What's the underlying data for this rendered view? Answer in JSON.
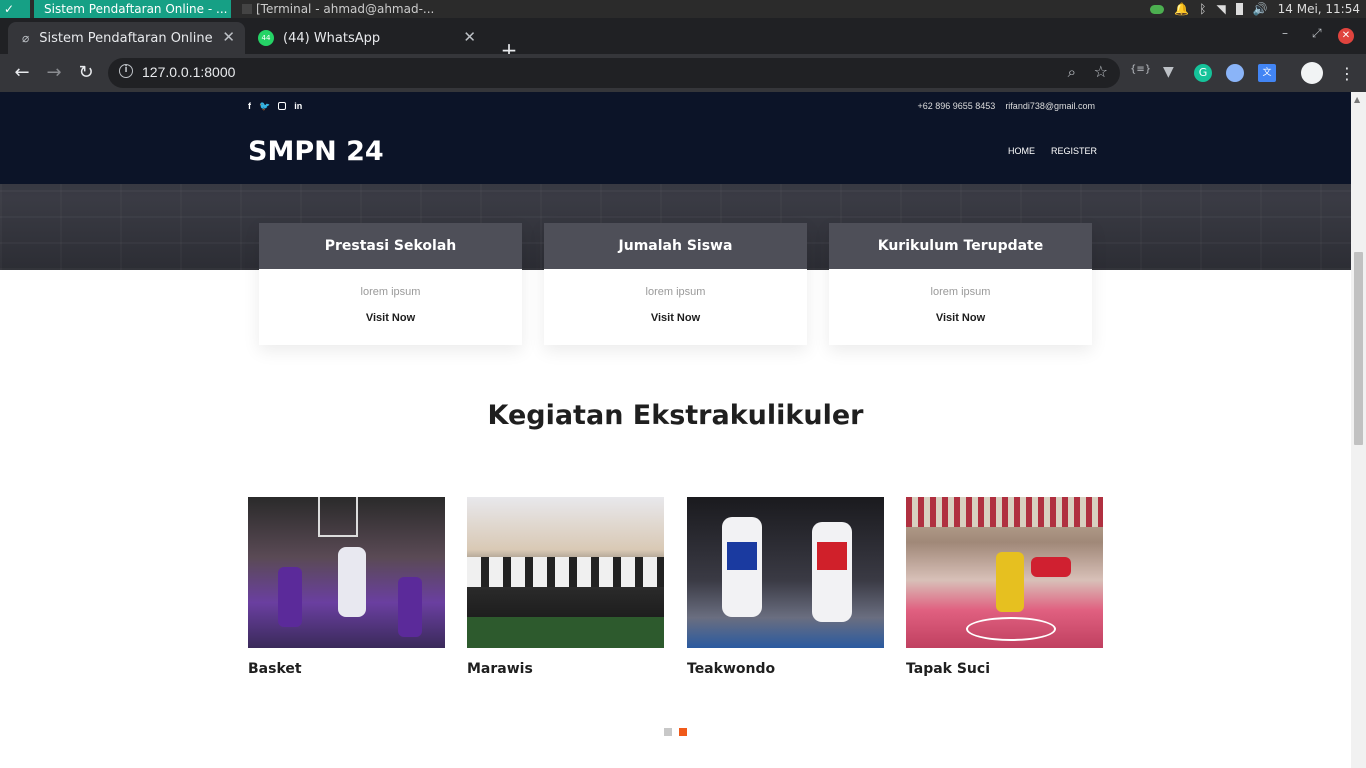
{
  "os": {
    "apps": [
      {
        "label": "Sistem Pendaftaran Online - ..."
      },
      {
        "label": "[Terminal - ahmad@ahmad-..."
      }
    ],
    "clock": "14 Mei, 11:54"
  },
  "browser": {
    "tabs": [
      {
        "label": "Sistem Pendaftaran Online",
        "icon": "leaf-icon"
      },
      {
        "label": "(44) WhatsApp",
        "icon": "whatsapp-icon",
        "badge": "44"
      }
    ],
    "url": "127.0.0.1:8000"
  },
  "site": {
    "social": [
      "f",
      "t",
      "ig",
      "in"
    ],
    "phone": "+62 896 9655 8453",
    "email": "rifandi738@gmail.com",
    "brand": "SMPN 24",
    "nav": [
      "HOME",
      "REGISTER"
    ]
  },
  "cards": [
    {
      "title": "Prestasi Sekolah",
      "text": "lorem ipsum",
      "link": "Visit Now"
    },
    {
      "title": "Jumalah Siswa",
      "text": "lorem ipsum",
      "link": "Visit Now"
    },
    {
      "title": "Kurikulum Terupdate",
      "text": "lorem ipsum",
      "link": "Visit Now"
    }
  ],
  "section": {
    "title": "Kegiatan Ekstrakulikuler"
  },
  "activities": [
    {
      "title": "Basket"
    },
    {
      "title": "Marawis"
    },
    {
      "title": "Teakwondo"
    },
    {
      "title": "Tapak Suci"
    }
  ],
  "carousel": {
    "pages": 2,
    "active": 2
  },
  "colors": {
    "header": "#0c1428",
    "accent": "#f05a1a",
    "card_head": "#4e4f58"
  }
}
